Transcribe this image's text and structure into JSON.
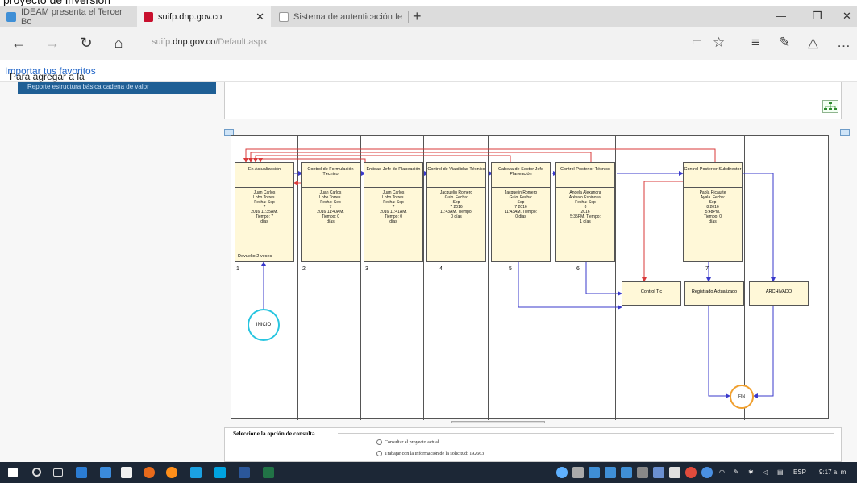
{
  "cut_heading": "proyecto de inversión",
  "tabs": [
    {
      "label": "IDEAM presenta el Tercer Bo",
      "favicon_color": "#3f8fd6"
    },
    {
      "label": "suifp.dnp.gov.co",
      "favicon_color": "#c8102e"
    },
    {
      "label": "Sistema de autenticación fe",
      "favicon_color": "#bcbcbc"
    }
  ],
  "address": {
    "prefix": "suifp.",
    "host": "dnp.gov.co",
    "path": "/Default.aspx"
  },
  "favorites_bar": {
    "text": "Para agregar a la barra de favoritos, selecciona ☆ o consíguelos de otro navegador.",
    "link": "Importar tus favoritos"
  },
  "sidebar_item": "Reporte estructura básica cadena de valor",
  "workflow": {
    "stages": [
      {
        "title": "En Actualización",
        "detail": [
          "Juan Carlos",
          "Lobo Torres.",
          "Fecha: Sep",
          "7",
          "2016 11:35AM.",
          "Tiempo: 7",
          "días"
        ],
        "extra": "Devuelto 2 veces",
        "number": "1"
      },
      {
        "title": "Control de Formulación Técnico",
        "detail": [
          "Juan Carlos",
          "Lobo Torres.",
          "Fecha: Sep",
          "7",
          "2016 11:40AM.",
          "Tiempo: 0",
          "días"
        ],
        "number": "2"
      },
      {
        "title": "Entidad Jefe de Planeación",
        "detail": [
          "Juan Carlos",
          "Lobo Torres.",
          "Fecha: Sep",
          "7",
          "2016 11:41AM.",
          "Tiempo: 0",
          "días"
        ],
        "number": "3"
      },
      {
        "title": "Control de Viabilidad Técnico",
        "detail": [
          "Jacquelin Romero",
          "Guio. Fecha:",
          "Sep",
          "7 2016",
          "11:43AM. Tiempo:",
          "0 días"
        ],
        "number": "4"
      },
      {
        "title": "Cabeza de Sector Jefe Planeación",
        "detail": [
          "Jacquelin Romero",
          "Guio. Fecha:",
          "Sep",
          "7 2016",
          "11:43AM. Tiempo:",
          "0 días"
        ],
        "number": "5"
      },
      {
        "title": "Control Posterior Técnico",
        "detail": [
          "Angela Alexandra",
          "Arévalo Espinosa.",
          "Fecha: Sep",
          "8",
          "2016",
          "5:35PM. Tiempo:",
          "1 días"
        ],
        "number": "6"
      },
      {
        "title": "Control Posterior Subdirector",
        "detail": [
          "Paola Ricaurte",
          "Ayala. Fecha:",
          "Sep",
          "8 2016",
          "5:48PM.",
          "Tiempo: 0",
          "días"
        ],
        "number": "7"
      }
    ],
    "nodes": {
      "control_tic": "Control Tic",
      "registrado": "Registrado Actualizado",
      "archivado": "ARCHIVADO",
      "inicio": "INICIO",
      "fin": "FIN"
    },
    "colors": {
      "forward": "#3a3acb",
      "return": "#d93a3a",
      "inicio": "#27c5e0",
      "fin": "#f0a030"
    }
  },
  "consult": {
    "heading": "Seleccione la opción de consulta",
    "options": [
      "Consultar el proyecto actual",
      "Trabajar con la información de la solicitud: 192663"
    ]
  },
  "taskbar": {
    "lang": "ESP",
    "time": "9:17 a. m."
  }
}
